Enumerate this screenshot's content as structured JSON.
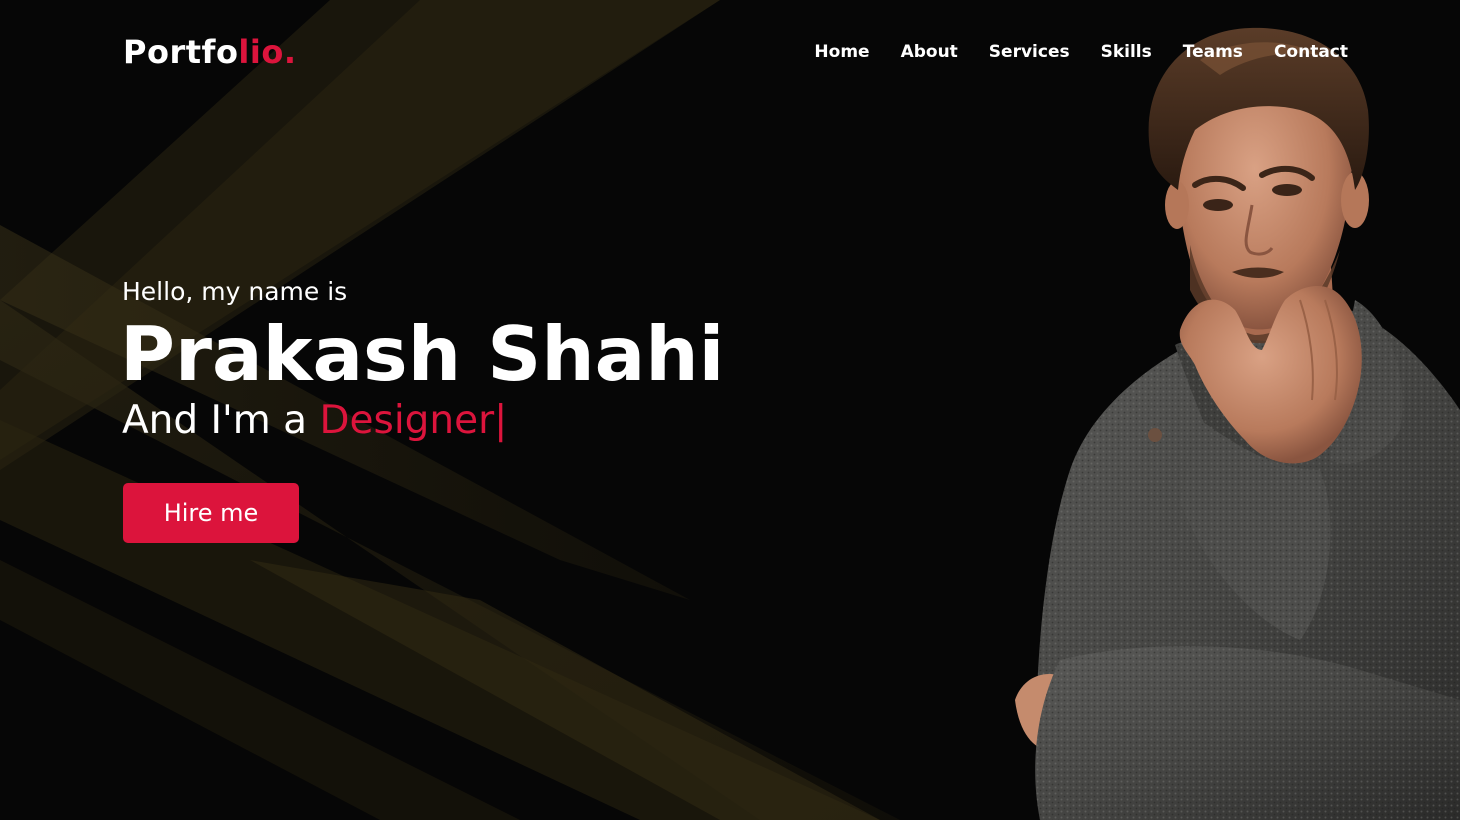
{
  "brand": {
    "logo_main": "Portfo",
    "logo_accent": "lio."
  },
  "nav": {
    "items": [
      {
        "label": "Home"
      },
      {
        "label": "About"
      },
      {
        "label": "Services"
      },
      {
        "label": "Skills"
      },
      {
        "label": "Teams"
      },
      {
        "label": "Contact"
      }
    ]
  },
  "hero": {
    "greeting": "Hello, my name is",
    "name": "Prakash Shahi",
    "role_prefix": "And I'm a ",
    "role_word": "Designer",
    "cursor": "|",
    "button_label": "Hire me"
  },
  "colors": {
    "accent": "#dc143c",
    "background": "#060606",
    "text": "#ffffff"
  }
}
